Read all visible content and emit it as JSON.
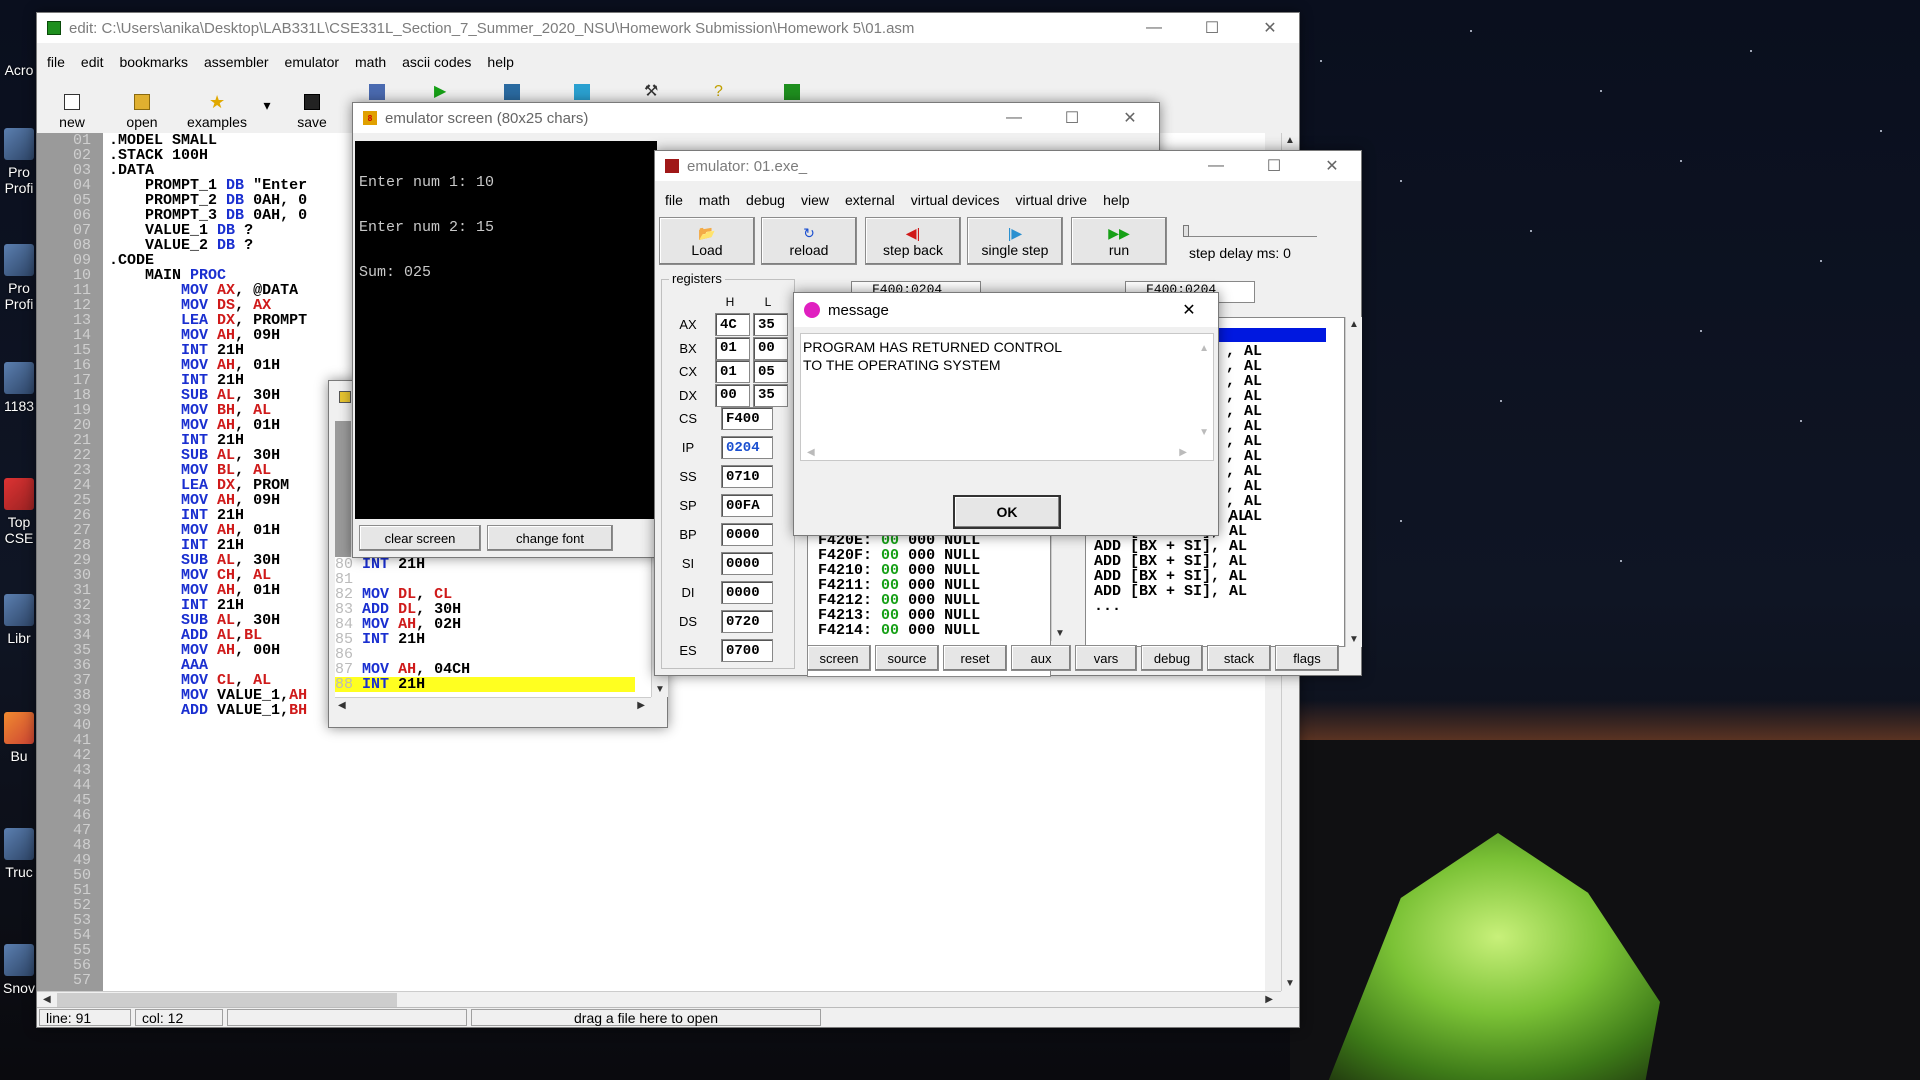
{
  "desktop": {
    "icons": [
      "Acro",
      "Pro Profi",
      "Pro Profi",
      "1183",
      "Top CSE",
      "Libr",
      "Bu",
      "Truc",
      "Snov"
    ]
  },
  "editor_window": {
    "title": "edit: C:\\Users\\anika\\Desktop\\LAB331L\\CSE331L_Section_7_Summer_2020_NSU\\Homework Submission\\Homework 5\\01.asm",
    "menu": [
      "file",
      "edit",
      "bookmarks",
      "assembler",
      "emulator",
      "math",
      "ascii codes",
      "help"
    ],
    "toolbar": [
      "new",
      "open",
      "examples",
      "save"
    ],
    "line_numbers": [
      "01",
      "02",
      "03",
      "04",
      "05",
      "06",
      "07",
      "08",
      "09",
      "10",
      "11",
      "12",
      "13",
      "14",
      "15",
      "16",
      "17",
      "18",
      "19",
      "20",
      "21",
      "22",
      "23",
      "24",
      "25",
      "26",
      "27",
      "28",
      "29",
      "30",
      "31",
      "32",
      "33",
      "34",
      "35",
      "36",
      "37",
      "38",
      "39",
      "40",
      "41",
      "42",
      "43",
      "44",
      "45",
      "46",
      "47",
      "48",
      "49",
      "50",
      "51",
      "52",
      "53",
      "54",
      "55",
      "56",
      "57"
    ],
    "code": [
      ".MODEL SMALL",
      ".STACK 100H",
      ".DATA",
      "    PROMPT_1 DB \"Enter",
      "    PROMPT_2 DB 0AH, 0",
      "    PROMPT_3 DB 0AH, 0",
      "",
      "    VALUE_1 DB ?",
      "    VALUE_2 DB ?",
      ".CODE",
      "    MAIN PROC",
      "        MOV AX, @DATA",
      "        MOV DS, AX",
      "",
      "        LEA DX, PROMPT",
      "        MOV AH, 09H",
      "        INT 21H",
      "",
      "        MOV AH, 01H",
      "        INT 21H",
      "",
      "        SUB AL, 30H",
      "        MOV BH, AL",
      "",
      "        MOV AH, 01H",
      "        INT 21H",
      "",
      "        SUB AL, 30H",
      "        MOV BL, AL",
      "",
      "        LEA DX, PROM",
      "        MOV AH, 09H",
      "        INT 21H",
      "",
      "        MOV AH, 01H",
      "        INT 21H",
      "",
      "        SUB AL, 30H",
      "        MOV CH, AL",
      "",
      "        MOV AH, 01H",
      "        INT 21H",
      "",
      "        SUB AL, 30H",
      "",
      "",
      "        ADD AL,BL",
      "",
      "",
      "",
      "        MOV AH, 00H",
      "        AAA",
      "",
      "        MOV CL, AL",
      "        MOV VALUE_1,AH",
      "",
      "        ADD VALUE_1,BH"
    ],
    "status": {
      "line": "line: 91",
      "col": "col: 12",
      "hint": "drag a file here to open"
    }
  },
  "source_window": {
    "line_numbers": [
      "80",
      "81",
      "82",
      "83",
      "84",
      "85",
      "86",
      "87",
      "88"
    ],
    "code": [
      "INT 21H",
      "",
      "MOV DL, CL",
      "ADD DL, 30H",
      "MOV AH, 02H",
      "INT 21H",
      "",
      "MOV AH, 04CH",
      "INT 21H"
    ],
    "highlighted_line": 8
  },
  "emulator_screen": {
    "title": "emulator screen (80x25 chars)",
    "output": [
      "Enter num 1: 10",
      "Enter num 2: 15",
      "Sum: 025"
    ],
    "buttons": [
      "clear screen",
      "change font"
    ]
  },
  "emulator": {
    "title": "emulator: 01.exe_",
    "menu": [
      "file",
      "math",
      "debug",
      "view",
      "external",
      "virtual devices",
      "virtual drive",
      "help"
    ],
    "toolbar": [
      "Load",
      "reload",
      "step back",
      "single step",
      "run"
    ],
    "step_delay": "step delay ms: 0",
    "registers_label": "registers",
    "hl": [
      "H",
      "L"
    ],
    "general": [
      {
        "name": "AX",
        "h": "4C",
        "l": "35"
      },
      {
        "name": "BX",
        "h": "01",
        "l": "00"
      },
      {
        "name": "CX",
        "h": "01",
        "l": "05"
      },
      {
        "name": "DX",
        "h": "00",
        "l": "35"
      }
    ],
    "segment": [
      {
        "name": "CS",
        "v": "F400"
      },
      {
        "name": "IP",
        "v": "0204"
      },
      {
        "name": "SS",
        "v": "0710"
      },
      {
        "name": "SP",
        "v": "00FA"
      },
      {
        "name": "BP",
        "v": "0000"
      },
      {
        "name": "SI",
        "v": "0000"
      },
      {
        "name": "DI",
        "v": "0000"
      },
      {
        "name": "DS",
        "v": "0720"
      },
      {
        "name": "ES",
        "v": "0700"
      }
    ],
    "addr_left": "F400:0204",
    "addr_right": "F400:0204",
    "memory": [
      {
        "addr": "F420E:",
        "a": "00",
        "b": "000",
        "c": "NULL"
      },
      {
        "addr": "F420F:",
        "a": "00",
        "b": "000",
        "c": "NULL"
      },
      {
        "addr": "F4210:",
        "a": "00",
        "b": "000",
        "c": "NULL"
      },
      {
        "addr": "F4211:",
        "a": "00",
        "b": "000",
        "c": "NULL"
      },
      {
        "addr": "F4212:",
        "a": "00",
        "b": "000",
        "c": "NULL"
      },
      {
        "addr": "F4213:",
        "a": "00",
        "b": "000",
        "c": "NULL"
      },
      {
        "addr": "F4214:",
        "a": "00",
        "b": "000",
        "c": "NULL"
      }
    ],
    "disasm_right": [
      ", AL",
      ", AL",
      ", AL",
      ", AL",
      ", AL",
      ", AL",
      ", AL",
      ", AL",
      ", AL",
      ", AL",
      ", AL",
      ", AL"
    ],
    "disasm_rows": [
      "ADD [BX + SI], AL",
      "ADD [BX + SI], AL",
      "ADD [BX + SI], AL",
      "ADD [BX + SI], AL",
      "ADD [BX + SI], AL",
      "ADD [BX + SI], AL",
      "..."
    ],
    "bottom_buttons": [
      "screen",
      "source",
      "reset",
      "aux",
      "vars",
      "debug",
      "stack",
      "flags"
    ]
  },
  "message": {
    "title": "message",
    "text": [
      "PROGRAM HAS RETURNED CONTROL",
      "TO THE OPERATING SYSTEM"
    ],
    "ok": "OK"
  }
}
